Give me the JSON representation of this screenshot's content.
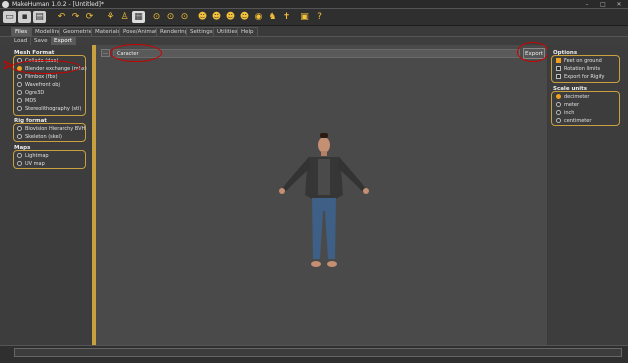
{
  "window": {
    "title": "MakeHuman 1.0.2 - [Untitled]*",
    "minimize": "–",
    "maximize": "□",
    "close": "✕"
  },
  "main_tabs": [
    "Files",
    "Modelling",
    "Geometries",
    "Materials",
    "Pose/Animate",
    "Rendering",
    "Settings",
    "Utilities",
    "Help"
  ],
  "sub_tabs": [
    "Load",
    "Save",
    "Export"
  ],
  "mesh_format": {
    "title": "Mesh Format",
    "options": [
      "Collada (dae)",
      "Blender exchange (mhx)",
      "Filmbox (fbx)",
      "Wavefront obj",
      "Ogre3D",
      "MD5",
      "Stereolithography (stl)"
    ],
    "selected_index": 1
  },
  "rig_format": {
    "title": "Rig format",
    "options": [
      "Biovision Hierarchy BVH",
      "Skeleton (skel)"
    ]
  },
  "maps": {
    "title": "Maps",
    "options": [
      "Lightmap",
      "UV map"
    ]
  },
  "export_bar": {
    "browse_label": "...",
    "filename": "Caracter",
    "export_label": "Export"
  },
  "options": {
    "title": "Options",
    "items": [
      {
        "label": "Feet on ground",
        "checked": true
      },
      {
        "label": "Rotation limits",
        "checked": false
      },
      {
        "label": "Export for Rigify",
        "checked": false
      }
    ]
  },
  "scale_units": {
    "title": "Scale units",
    "options": [
      "decimeter",
      "meter",
      "inch",
      "centimeter"
    ],
    "selected_index": 0
  },
  "colors": {
    "accent": "#c8a040",
    "selected": "#f0a020",
    "annotation": "#cc0000"
  }
}
